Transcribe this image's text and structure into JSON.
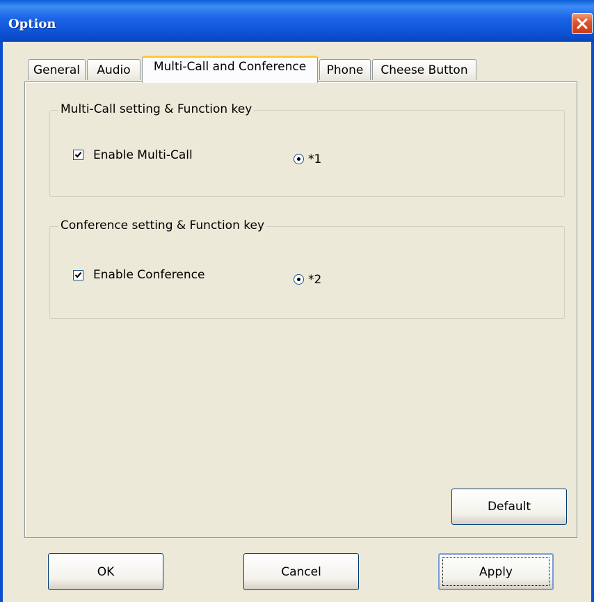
{
  "window": {
    "title": "Option"
  },
  "tabs": [
    {
      "label": "General",
      "active": false
    },
    {
      "label": "Audio",
      "active": false
    },
    {
      "label": "Multi-Call and Conference",
      "active": true
    },
    {
      "label": "Phone",
      "active": false
    },
    {
      "label": "Cheese Button",
      "active": false
    }
  ],
  "multicall_group": {
    "legend": "Multi-Call setting & Function key",
    "checkbox_label": "Enable Multi-Call",
    "checked": true,
    "radio_label": "*1",
    "radio_selected": true
  },
  "conference_group": {
    "legend": "Conference setting & Function key",
    "checkbox_label": "Enable Conference",
    "checked": true,
    "radio_label": "*2",
    "radio_selected": true
  },
  "buttons": {
    "default": "Default",
    "ok": "OK",
    "cancel": "Cancel",
    "apply": "Apply"
  },
  "colors": {
    "titlebar": "#0a5fd8",
    "close_button": "#e0552f",
    "dialog_background": "#ece9d8",
    "active_tab_accent": "#ffc83c"
  }
}
